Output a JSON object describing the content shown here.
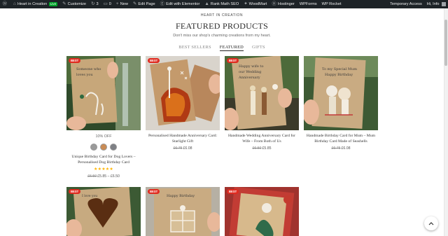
{
  "admin_bar": {
    "site_name": "Heart in Creation",
    "live_label": "Live",
    "customize_label": "Customize",
    "updates_count": "3",
    "comments_count": "0",
    "new_label": "New",
    "edit_page_label": "Edit Page",
    "elementor_label": "Edit with Elementor",
    "rankmath_label": "Rank Math SEO",
    "woodmart_label": "WoodMart",
    "hostinger_label": "Hostinger",
    "wpforms_label": "WPForms",
    "wprocket_label": "WP Rocket",
    "temporary_access_label": "Temporary Access",
    "greeting": "Hi, Info"
  },
  "section": {
    "eyebrow": "HEART IN CREATION",
    "title": "FEATURED PRODUCTS",
    "subtitle": "Don't miss our shop's charming creations from my heart.",
    "tabs": [
      "BEST SELLERS",
      "FEATURED",
      "GIFTS"
    ],
    "active_tab": "FEATURED"
  },
  "products": [
    {
      "badge": "BEST",
      "discount": "10% OFF",
      "swatches": [
        "#9a9a9a",
        "#c98b55",
        "#7e8085"
      ],
      "title": "Unique Birthday Card for Dog Lovers – Personalised Dog Birthday Card",
      "stars": "★★★★★",
      "old_price": "£6.50",
      "price": "£5.85 – £6.50"
    },
    {
      "badge": "BEST",
      "title": "Personalised Handmade Anniversary Card: Starlight Gift",
      "old_price": "£6.75",
      "price": "£6.08"
    },
    {
      "badge": "BEST",
      "title": "Handmade Wedding Anniversary Card for Wife – From Both of Us",
      "old_price": "£6.50",
      "price": "£5.85"
    },
    {
      "badge": "",
      "title": "Handmade Birthday Card for Mum – Mum Birthday Card Made of Seashells",
      "old_price": "£6.75",
      "price": "£6.08"
    },
    {
      "badge": "BEST"
    },
    {
      "badge": "BEST"
    },
    {
      "badge": "BEST"
    }
  ],
  "colors": {
    "admin_bar_bg": "#1d2327",
    "badge_red": "#e02b20",
    "live_green": "#00a32a",
    "star_gold": "#ffb400"
  },
  "icons": {
    "back_to_top": "chevron-up-icon"
  }
}
